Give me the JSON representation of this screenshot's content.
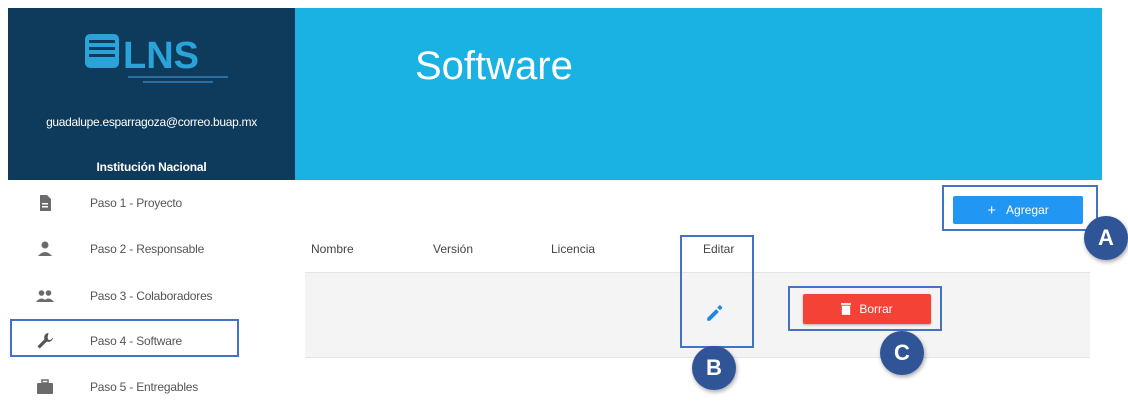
{
  "sidebar": {
    "logo_text": "LNS",
    "email": "guadalupe.esparragoza@correo.buap.mx",
    "institution": "Institución Nacional",
    "items": [
      {
        "label": "Paso 1 - Proyecto",
        "icon": "document-icon"
      },
      {
        "label": "Paso 2 - Responsable",
        "icon": "person-icon"
      },
      {
        "label": "Paso 3 - Colaboradores",
        "icon": "people-icon"
      },
      {
        "label": "Paso 4 - Software",
        "icon": "wrench-icon",
        "active": true
      },
      {
        "label": "Paso 5 - Entregables",
        "icon": "briefcase-icon"
      }
    ]
  },
  "header": {
    "title": "Software"
  },
  "toolbar": {
    "add_label": "Agregar",
    "add_icon": "+"
  },
  "table": {
    "columns": [
      "Nombre",
      "Versión",
      "Licencia",
      "Editar"
    ],
    "rows": [
      {
        "delete_label": "Borrar"
      }
    ]
  },
  "callouts": [
    "A",
    "B",
    "C"
  ],
  "colors": {
    "sidebar_bg": "#0e3a5c",
    "header_bg": "#1ab1e3",
    "primary_button": "#2196f3",
    "danger_button": "#f44336",
    "highlight": "#4472c4",
    "callout_bg": "#2f5597"
  }
}
